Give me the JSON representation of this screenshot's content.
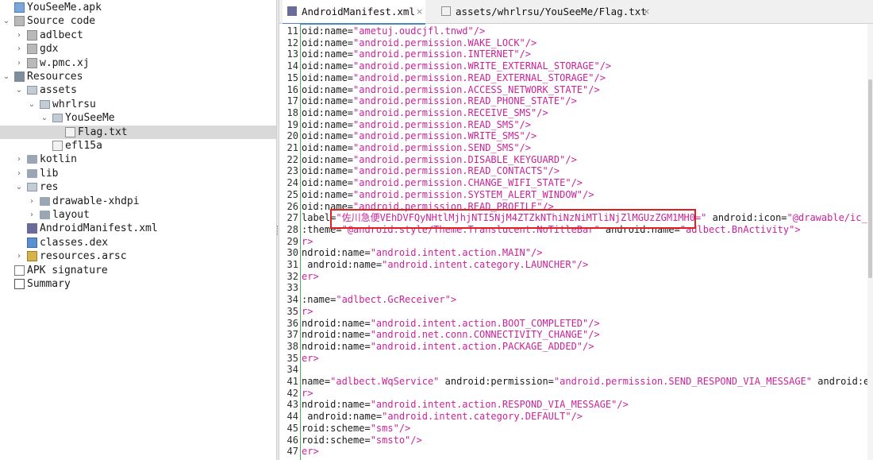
{
  "tree": {
    "items": [
      {
        "label": "YouSeeMe.apk",
        "icon": "apk-icon",
        "toggle": "",
        "depth": 0
      },
      {
        "label": "Source code",
        "icon": "package-icon",
        "toggle": "v",
        "depth": 0
      },
      {
        "label": "adlbect",
        "icon": "package-icon",
        "toggle": ">",
        "depth": 1
      },
      {
        "label": "gdx",
        "icon": "package-icon",
        "toggle": ">",
        "depth": 1
      },
      {
        "label": "w.pmc.xj",
        "icon": "package-icon",
        "toggle": ">",
        "depth": 1
      },
      {
        "label": "Resources",
        "icon": "resources-icon",
        "toggle": "v",
        "depth": 0
      },
      {
        "label": "assets",
        "icon": "folder-open-icon",
        "toggle": "v",
        "depth": 1
      },
      {
        "label": "whrlrsu",
        "icon": "folder-open-icon",
        "toggle": "v",
        "depth": 2
      },
      {
        "label": "YouSeeMe",
        "icon": "folder-open-icon",
        "toggle": "v",
        "depth": 3
      },
      {
        "label": "Flag.txt",
        "icon": "file-icon",
        "toggle": "",
        "depth": 4,
        "selected": true
      },
      {
        "label": "efl15a",
        "icon": "file-icon",
        "toggle": "",
        "depth": 3
      },
      {
        "label": "kotlin",
        "icon": "folder-icon",
        "toggle": ">",
        "depth": 1
      },
      {
        "label": "lib",
        "icon": "folder-icon",
        "toggle": ">",
        "depth": 1
      },
      {
        "label": "res",
        "icon": "folder-open-icon",
        "toggle": "v",
        "depth": 1
      },
      {
        "label": "drawable-xhdpi",
        "icon": "folder-icon",
        "toggle": ">",
        "depth": 2
      },
      {
        "label": "layout",
        "icon": "folder-icon",
        "toggle": ">",
        "depth": 2
      },
      {
        "label": "AndroidManifest.xml",
        "icon": "manifest-icon",
        "toggle": "",
        "depth": 1
      },
      {
        "label": "classes.dex",
        "icon": "dex-icon",
        "toggle": "",
        "depth": 1
      },
      {
        "label": "resources.arsc",
        "icon": "arsc-icon",
        "toggle": ">",
        "depth": 1
      },
      {
        "label": "APK signature",
        "icon": "signature-icon",
        "toggle": "",
        "depth": 0
      },
      {
        "label": "Summary",
        "icon": "summary-icon",
        "toggle": "",
        "depth": 0
      }
    ]
  },
  "tabs": [
    {
      "label": "AndroidManifest.xml",
      "close": "×",
      "active": true
    },
    {
      "label": "assets/whrlrsu/YouSeeMe/Flag.txt",
      "close": "×",
      "active": false
    }
  ],
  "code_lines": [
    {
      "n": "11",
      "segs": [
        [
          "attr",
          "oid:name="
        ],
        [
          "val",
          "\"ametuj.oudcjfl.tnwd\""
        ],
        [
          "tag",
          "/>"
        ]
      ]
    },
    {
      "n": "12",
      "segs": [
        [
          "attr",
          "oid:name="
        ],
        [
          "val",
          "\"android.permission.WAKE_LOCK\""
        ],
        [
          "tag",
          "/>"
        ]
      ]
    },
    {
      "n": "13",
      "segs": [
        [
          "attr",
          "oid:name="
        ],
        [
          "val",
          "\"android.permission.INTERNET\""
        ],
        [
          "tag",
          "/>"
        ]
      ]
    },
    {
      "n": "14",
      "segs": [
        [
          "attr",
          "oid:name="
        ],
        [
          "val",
          "\"android.permission.WRITE_EXTERNAL_STORAGE\""
        ],
        [
          "tag",
          "/>"
        ]
      ]
    },
    {
      "n": "15",
      "segs": [
        [
          "attr",
          "oid:name="
        ],
        [
          "val",
          "\"android.permission.READ_EXTERNAL_STORAGE\""
        ],
        [
          "tag",
          "/>"
        ]
      ]
    },
    {
      "n": "16",
      "segs": [
        [
          "attr",
          "oid:name="
        ],
        [
          "val",
          "\"android.permission.ACCESS_NETWORK_STATE\""
        ],
        [
          "tag",
          "/>"
        ]
      ]
    },
    {
      "n": "17",
      "segs": [
        [
          "attr",
          "oid:name="
        ],
        [
          "val",
          "\"android.permission.READ_PHONE_STATE\""
        ],
        [
          "tag",
          "/>"
        ]
      ]
    },
    {
      "n": "18",
      "segs": [
        [
          "attr",
          "oid:name="
        ],
        [
          "val",
          "\"android.permission.RECEIVE_SMS\""
        ],
        [
          "tag",
          "/>"
        ]
      ]
    },
    {
      "n": "19",
      "segs": [
        [
          "attr",
          "oid:name="
        ],
        [
          "val",
          "\"android.permission.READ_SMS\""
        ],
        [
          "tag",
          "/>"
        ]
      ]
    },
    {
      "n": "20",
      "segs": [
        [
          "attr",
          "oid:name="
        ],
        [
          "val",
          "\"android.permission.WRITE_SMS\""
        ],
        [
          "tag",
          "/>"
        ]
      ]
    },
    {
      "n": "21",
      "segs": [
        [
          "attr",
          "oid:name="
        ],
        [
          "val",
          "\"android.permission.SEND_SMS\""
        ],
        [
          "tag",
          "/>"
        ]
      ]
    },
    {
      "n": "22",
      "segs": [
        [
          "attr",
          "oid:name="
        ],
        [
          "val",
          "\"android.permission.DISABLE_KEYGUARD\""
        ],
        [
          "tag",
          "/>"
        ]
      ]
    },
    {
      "n": "23",
      "segs": [
        [
          "attr",
          "oid:name="
        ],
        [
          "val",
          "\"android.permission.READ_CONTACTS\""
        ],
        [
          "tag",
          "/>"
        ]
      ]
    },
    {
      "n": "24",
      "segs": [
        [
          "attr",
          "oid:name="
        ],
        [
          "val",
          "\"android.permission.CHANGE_WIFI_STATE\""
        ],
        [
          "tag",
          "/>"
        ]
      ]
    },
    {
      "n": "25",
      "segs": [
        [
          "attr",
          "oid:name="
        ],
        [
          "val",
          "\"android.permission.SYSTEM_ALERT_WINDOW\""
        ],
        [
          "tag",
          "/>"
        ]
      ]
    },
    {
      "n": "26",
      "segs": [
        [
          "attr",
          "oid:name="
        ],
        [
          "val",
          "\"android.permission.READ_PROFILE\""
        ],
        [
          "tag",
          "/>"
        ]
      ]
    },
    {
      "n": "27",
      "segs": [
        [
          "attr",
          "label="
        ],
        [
          "val",
          "\"佐川急便VEhDVFQyNHtlMjhjNTI5NjM4ZTZkNThiNzNiMTliNjZlMGUzZGM1MH0=\""
        ],
        [
          "attr",
          " android:icon="
        ],
        [
          "val",
          "\"@drawable/ic_laun"
        ]
      ]
    },
    {
      "n": "28",
      "segs": [
        [
          "attr",
          ":theme="
        ],
        [
          "val",
          "\"@android:style/Theme.Translucent.NoTitleBar\""
        ],
        [
          "attr",
          " android:name="
        ],
        [
          "val",
          "\"adlbect.BnActivity\""
        ],
        [
          "tag",
          ">"
        ]
      ]
    },
    {
      "n": "29",
      "segs": [
        [
          "tag",
          "r>"
        ]
      ]
    },
    {
      "n": "30",
      "segs": [
        [
          "attr",
          "ndroid:name="
        ],
        [
          "val",
          "\"android.intent.action.MAIN\""
        ],
        [
          "tag",
          "/>"
        ]
      ]
    },
    {
      "n": "31",
      "segs": [
        [
          "attr",
          " android:name="
        ],
        [
          "val",
          "\"android.intent.category.LAUNCHER\""
        ],
        [
          "tag",
          "/>"
        ]
      ]
    },
    {
      "n": "32",
      "segs": [
        [
          "tag",
          "er>"
        ]
      ]
    },
    {
      "n": "33",
      "segs": [
        [
          "attr",
          ""
        ]
      ]
    },
    {
      "n": "34",
      "segs": [
        [
          "attr",
          ":name="
        ],
        [
          "val",
          "\"adlbect.GcReceiver\""
        ],
        [
          "tag",
          ">"
        ]
      ]
    },
    {
      "n": "35",
      "segs": [
        [
          "tag",
          "r>"
        ]
      ]
    },
    {
      "n": "36",
      "segs": [
        [
          "attr",
          "ndroid:name="
        ],
        [
          "val",
          "\"android.intent.action.BOOT_COMPLETED\""
        ],
        [
          "tag",
          "/>"
        ]
      ]
    },
    {
      "n": "37",
      "segs": [
        [
          "attr",
          "ndroid:name="
        ],
        [
          "val",
          "\"android.net.conn.CONNECTIVITY_CHANGE\""
        ],
        [
          "tag",
          "/>"
        ]
      ]
    },
    {
      "n": "38",
      "segs": [
        [
          "attr",
          "ndroid:name="
        ],
        [
          "val",
          "\"android.intent.action.PACKAGE_ADDED\""
        ],
        [
          "tag",
          "/>"
        ]
      ]
    },
    {
      "n": "35",
      "segs": [
        [
          "tag",
          "er>"
        ]
      ]
    },
    {
      "n": "34",
      "segs": [
        [
          "attr",
          ""
        ]
      ]
    },
    {
      "n": "41",
      "segs": [
        [
          "attr",
          "name="
        ],
        [
          "val",
          "\"adlbect.WqService\""
        ],
        [
          "attr",
          " android:permission="
        ],
        [
          "val",
          "\"android.permission.SEND_RESPOND_VIA_MESSAGE\""
        ],
        [
          "attr",
          " android:expor"
        ]
      ]
    },
    {
      "n": "42",
      "segs": [
        [
          "tag",
          "r>"
        ]
      ]
    },
    {
      "n": "43",
      "segs": [
        [
          "attr",
          "ndroid:name="
        ],
        [
          "val",
          "\"android.intent.action.RESPOND_VIA_MESSAGE\""
        ],
        [
          "tag",
          "/>"
        ]
      ]
    },
    {
      "n": "44",
      "segs": [
        [
          "attr",
          " android:name="
        ],
        [
          "val",
          "\"android.intent.category.DEFAULT\""
        ],
        [
          "tag",
          "/>"
        ]
      ]
    },
    {
      "n": "45",
      "segs": [
        [
          "attr",
          "roid:scheme="
        ],
        [
          "val",
          "\"sms\""
        ],
        [
          "tag",
          "/>"
        ]
      ]
    },
    {
      "n": "46",
      "segs": [
        [
          "attr",
          "roid:scheme="
        ],
        [
          "val",
          "\"smsto\""
        ],
        [
          "tag",
          "/>"
        ]
      ]
    },
    {
      "n": "47",
      "segs": [
        [
          "tag",
          "er>"
        ]
      ]
    }
  ],
  "colors": {
    "value": "#c8239a",
    "highlight_box": "#e02020",
    "gutter_line": "#4caf50",
    "selection": "#d9d9d9"
  }
}
